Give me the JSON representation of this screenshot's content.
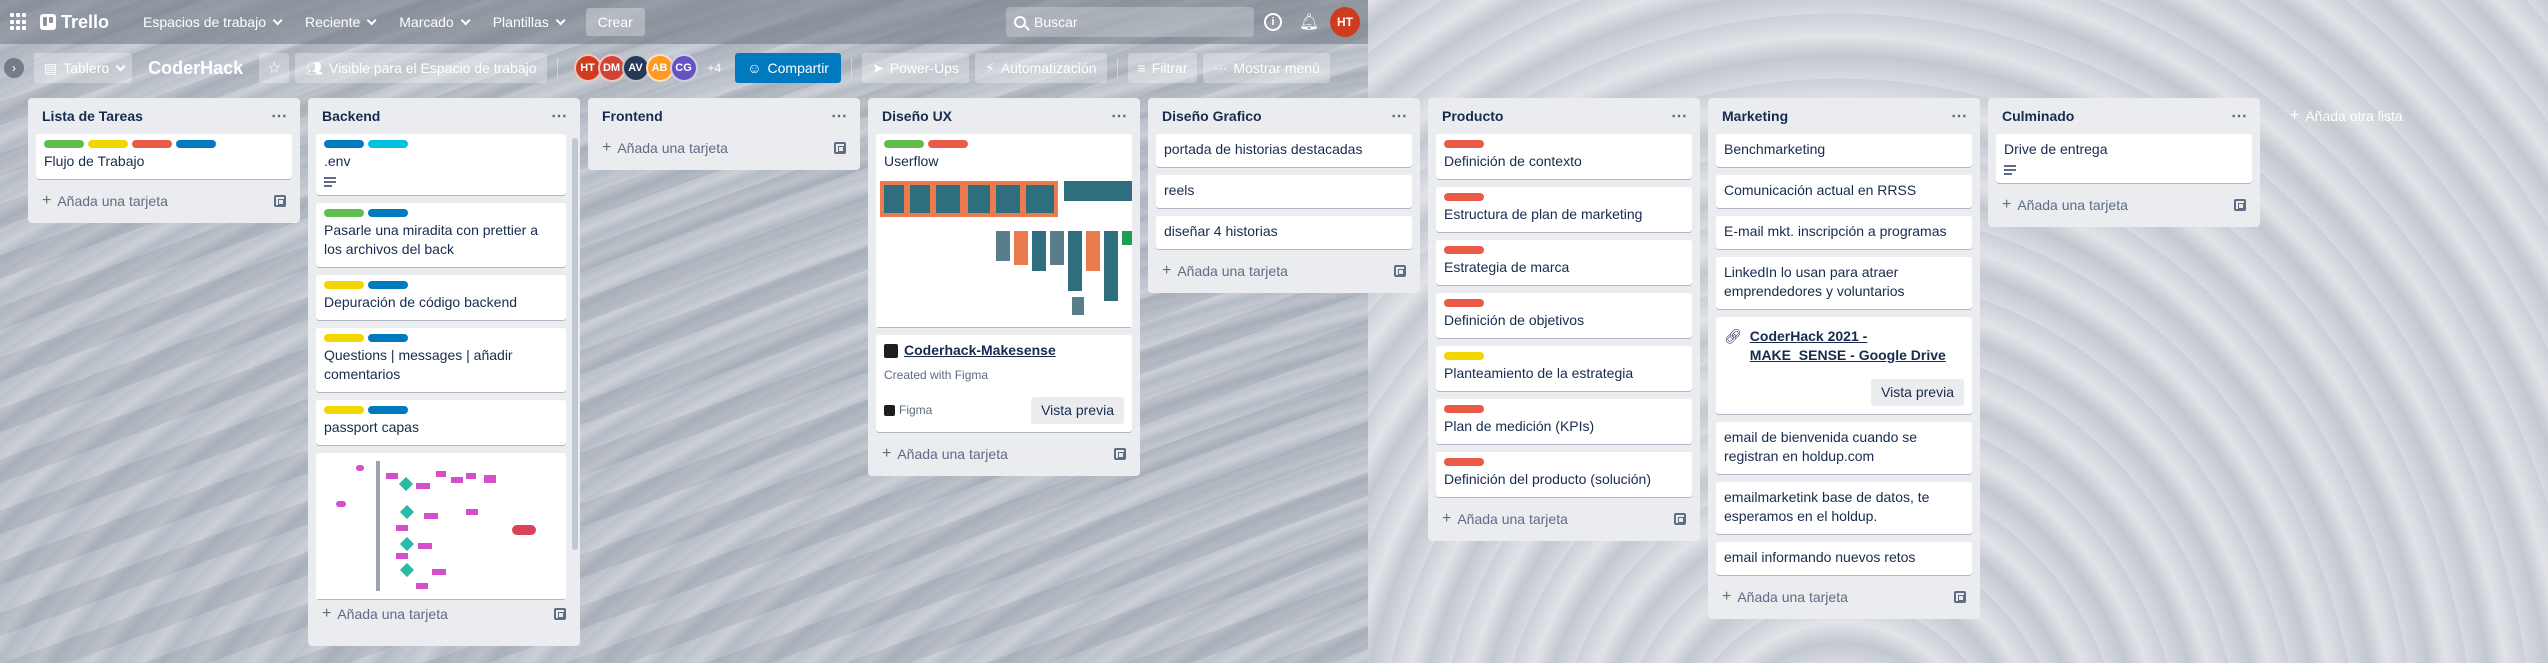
{
  "header": {
    "app_name": "Trello",
    "nav": [
      "Espacios de trabajo",
      "Reciente",
      "Marcado",
      "Plantillas"
    ],
    "create_label": "Crear",
    "search_placeholder": "Buscar",
    "user_initials": "HT"
  },
  "board": {
    "view_label": "Tablero",
    "title": "CoderHack",
    "visibility_label": "Visible para el Espacio de trabajo",
    "members": [
      {
        "initials": "HT",
        "color": "#cf3b1f"
      },
      {
        "initials": "DM",
        "color": "#d04437"
      },
      {
        "initials": "AV",
        "color": "#253858"
      },
      {
        "initials": "AB",
        "color": "#ff991f"
      },
      {
        "initials": "CG",
        "color": "#6554c0"
      }
    ],
    "more_members": "+4",
    "share_label": "Compartir",
    "powerups_label": "Power-Ups",
    "automation_label": "Automatización",
    "filter_label": "Filtrar",
    "menu_label": "Mostrar menú"
  },
  "add_card_label": "Añada una tarjeta",
  "add_list_label": "Añada otra lista",
  "lists": [
    {
      "title": "Lista de Tareas",
      "cards": [
        {
          "title": "Flujo de Trabajo",
          "labels": [
            "#61bd4f",
            "#f2d600",
            "#eb5a46",
            "#0079bf"
          ]
        }
      ]
    },
    {
      "title": "Backend",
      "cards": [
        {
          "title": ".env",
          "labels": [
            "#0079bf",
            "#00c2e0"
          ],
          "has_description": true
        },
        {
          "title": "Pasarle una miradita con prettier a los archivos del back",
          "labels": [
            "#61bd4f",
            "#0079bf"
          ]
        },
        {
          "title": "Depuración de código backend",
          "labels": [
            "#f2d600",
            "#0079bf"
          ]
        },
        {
          "title": "Questions | messages | añadir comentarios",
          "labels": [
            "#f2d600",
            "#0079bf"
          ]
        },
        {
          "title": "passport capas",
          "labels": [
            "#f2d600",
            "#0079bf"
          ]
        }
      ]
    },
    {
      "title": "Frontend",
      "cards": []
    },
    {
      "title": "Diseño UX",
      "cards": [
        {
          "title": "Userflow",
          "labels": [
            "#61bd4f",
            "#eb5a46"
          ]
        },
        {
          "title": "Coderhack-Makesense",
          "meta": "Created with Figma",
          "source": "Figma",
          "preview_label": "Vista previa"
        }
      ]
    },
    {
      "title": "Diseño Grafico",
      "cards": [
        {
          "title": "portada de historias destacadas"
        },
        {
          "title": "reels"
        },
        {
          "title": "diseñar 4 historias"
        }
      ]
    },
    {
      "title": "Producto",
      "cards": [
        {
          "title": "Definición de contexto",
          "labels": [
            "#eb5a46"
          ]
        },
        {
          "title": "Estructura de plan de marketing",
          "labels": [
            "#eb5a46"
          ]
        },
        {
          "title": "Estrategia de marca",
          "labels": [
            "#eb5a46"
          ]
        },
        {
          "title": "Definición de objetivos",
          "labels": [
            "#eb5a46"
          ]
        },
        {
          "title": "Planteamiento de la estrategia",
          "labels": [
            "#f2d600"
          ]
        },
        {
          "title": "Plan de medición (KPIs)",
          "labels": [
            "#eb5a46"
          ]
        },
        {
          "title": "Definición del producto (solución)",
          "labels": [
            "#eb5a46"
          ]
        }
      ]
    },
    {
      "title": "Marketing",
      "cards": [
        {
          "title": "Benchmarketing"
        },
        {
          "title": "Comunicación actual en RRSS"
        },
        {
          "title": "E-mail mkt. inscripción a programas"
        },
        {
          "title": "LinkedIn lo usan para atraer emprendedores y voluntarios"
        },
        {
          "title": "CoderHack 2021 - MAKE_SENSE - Google Drive",
          "preview_label": "Vista previa"
        },
        {
          "title": "email de bienvenida cuando se registran en holdup.com"
        },
        {
          "title": "emailmarketink base de datos, te esperamos en el holdup."
        },
        {
          "title": "email informando nuevos retos"
        }
      ]
    },
    {
      "title": "Culminado",
      "cards": [
        {
          "title": "Drive de entrega",
          "has_description": true
        }
      ]
    }
  ]
}
